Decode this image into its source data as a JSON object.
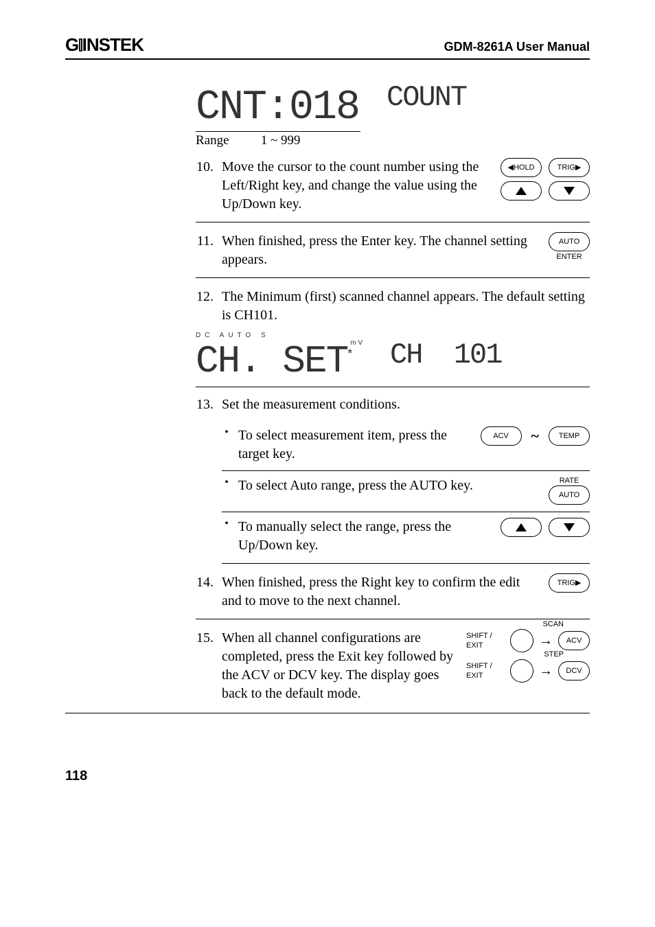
{
  "header": {
    "brand": "GWINSTEK",
    "docname": "GDM-8261A User Manual"
  },
  "display_count": {
    "primary": "CNT:018",
    "secondary": "COUNT",
    "range_label": "Range",
    "range_value": "1 ~ 999"
  },
  "steps": {
    "s10": {
      "num": "10.",
      "text": "Move the cursor to the count number using the Left/Right key, and change the value using the Up/Down key."
    },
    "s11": {
      "num": "11.",
      "text": "When finished, press the Enter key. The channel setting appears."
    },
    "s12": {
      "num": "12.",
      "text": "The Minimum (first) scanned channel appears. The default setting is CH101."
    },
    "s13": {
      "num": "13.",
      "text": "Set the measurement conditions.",
      "b1": "To select measurement item, press the target key.",
      "b2": "To select Auto range, press the AUTO key.",
      "b3": "To manually select the range, press the Up/Down key."
    },
    "s14": {
      "num": "14.",
      "text": "When finished, press the Right key to confirm the edit and to move to the next channel."
    },
    "s15": {
      "num": "15.",
      "text": "When all channel configurations are completed, press the Exit key followed by the ACV or DCV key. The display goes back to the default mode."
    }
  },
  "ch_display": {
    "ann": "DC      AUTO      S",
    "primary": "CH. SET",
    "unit_small": "m   V",
    "star": "*",
    "secondary": "CH  101"
  },
  "keys": {
    "hold": "◀HOLD",
    "trig": "TRIG▶",
    "auto": "AUTO",
    "enter": "ENTER",
    "acv": "ACV",
    "temp": "TEMP",
    "rate": "RATE",
    "dcv": "DCV",
    "scan": "SCAN",
    "step": "STEP",
    "shiftexit": "SHIFT / EXIT"
  },
  "footer": {
    "page": "118"
  }
}
